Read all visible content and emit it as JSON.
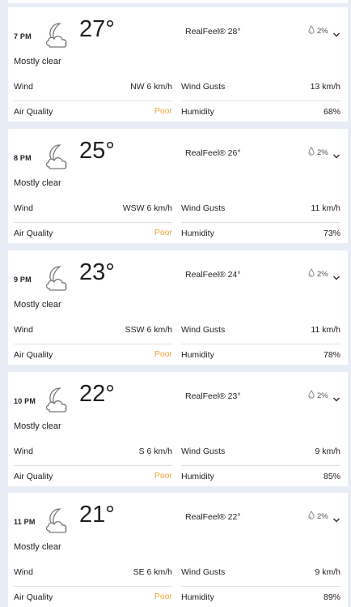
{
  "colors": {
    "page_bg": "#e8ecf5",
    "card_bg": "#ffffff",
    "air_quality_poor": "#f0a33b"
  },
  "labels": {
    "wind": "Wind",
    "wind_gusts": "Wind Gusts",
    "air_quality": "Air Quality",
    "humidity": "Humidity"
  },
  "hours": [
    {
      "time": "7 PM",
      "temp": "27°",
      "realfeel": "RealFeel® 28°",
      "precip": "2%",
      "phrase": "Mostly clear",
      "wind": "NW 6 km/h",
      "gusts": "13 km/h",
      "air_quality": "Poor",
      "humidity": "68%",
      "icon": "moon-cloud-icon"
    },
    {
      "time": "8 PM",
      "temp": "25°",
      "realfeel": "RealFeel® 26°",
      "precip": "2%",
      "phrase": "Mostly clear",
      "wind": "WSW 6 km/h",
      "gusts": "11 km/h",
      "air_quality": "Poor",
      "humidity": "73%",
      "icon": "moon-cloud-icon"
    },
    {
      "time": "9 PM",
      "temp": "23°",
      "realfeel": "RealFeel® 24°",
      "precip": "2%",
      "phrase": "Mostly clear",
      "wind": "SSW 6 km/h",
      "gusts": "11 km/h",
      "air_quality": "Poor",
      "humidity": "78%",
      "icon": "moon-cloud-icon"
    },
    {
      "time": "10 PM",
      "temp": "22°",
      "realfeel": "RealFeel® 23°",
      "precip": "2%",
      "phrase": "Mostly clear",
      "wind": "S 6 km/h",
      "gusts": "9 km/h",
      "air_quality": "Poor",
      "humidity": "85%",
      "icon": "moon-cloud-icon"
    },
    {
      "time": "11 PM",
      "temp": "21°",
      "realfeel": "RealFeel® 22°",
      "precip": "2%",
      "phrase": "Mostly clear",
      "wind": "SE 6 km/h",
      "gusts": "9 km/h",
      "air_quality": "Poor",
      "humidity": "89%",
      "icon": "moon-cloud-icon"
    }
  ]
}
